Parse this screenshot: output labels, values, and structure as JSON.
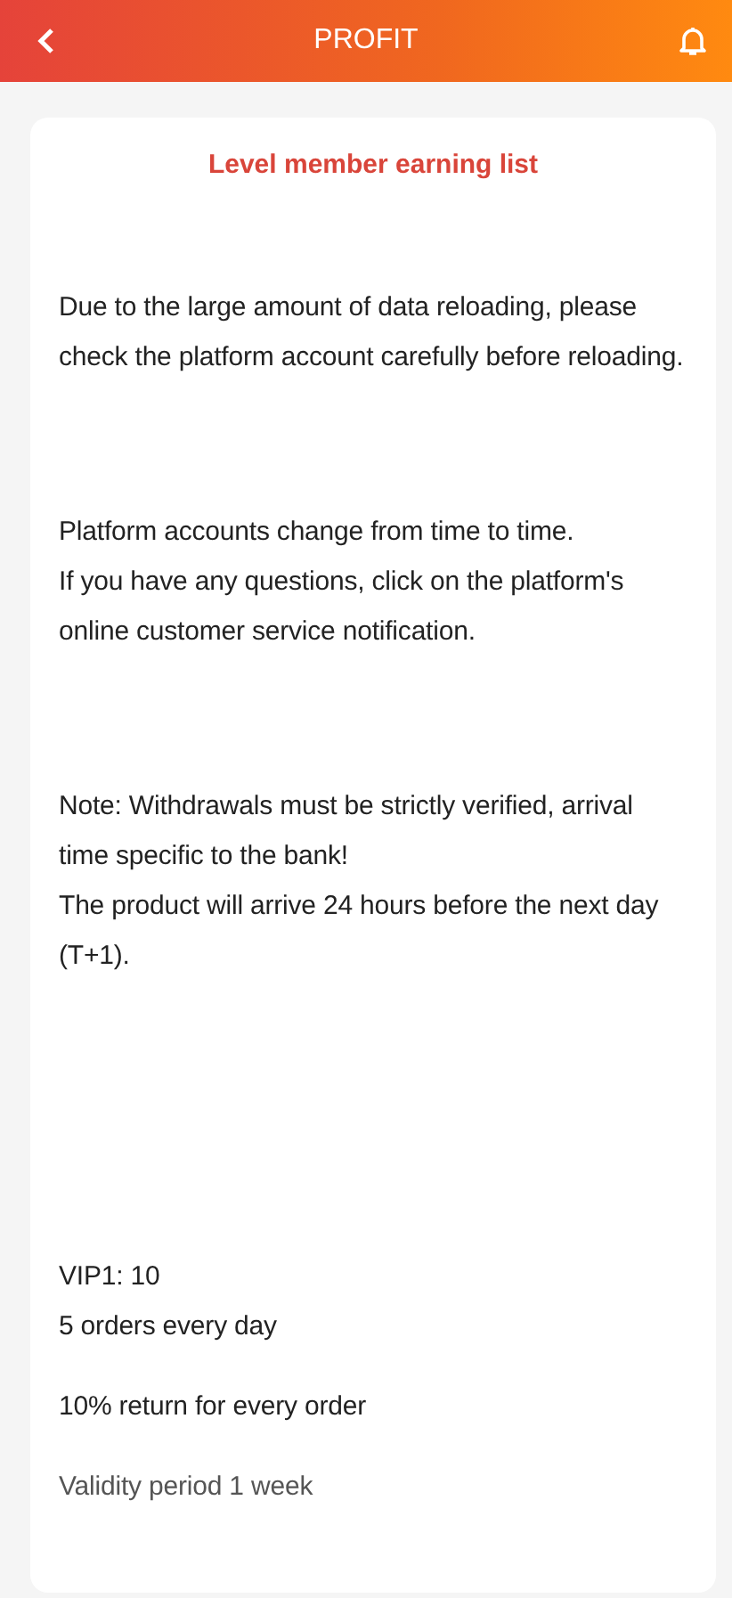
{
  "header": {
    "title": "PROFIT"
  },
  "card": {
    "title": "Level member earning list",
    "notices": [
      [
        "Due to the large amount of data reloading, please check the platform account carefully before reloading."
      ],
      [
        "Platform accounts change from time to time.",
        "If you have any questions, click on the platform's online customer service notification."
      ],
      [
        "Note: Withdrawals must be strictly verified, arrival time specific to the bank!",
        "The product will arrive 24 hours before the next day (T+1)."
      ]
    ],
    "vip": {
      "level": "VIP1: 10",
      "orders": "5 orders every day",
      "return": "10% return for every order",
      "validity": "Validity period 1 week"
    }
  }
}
